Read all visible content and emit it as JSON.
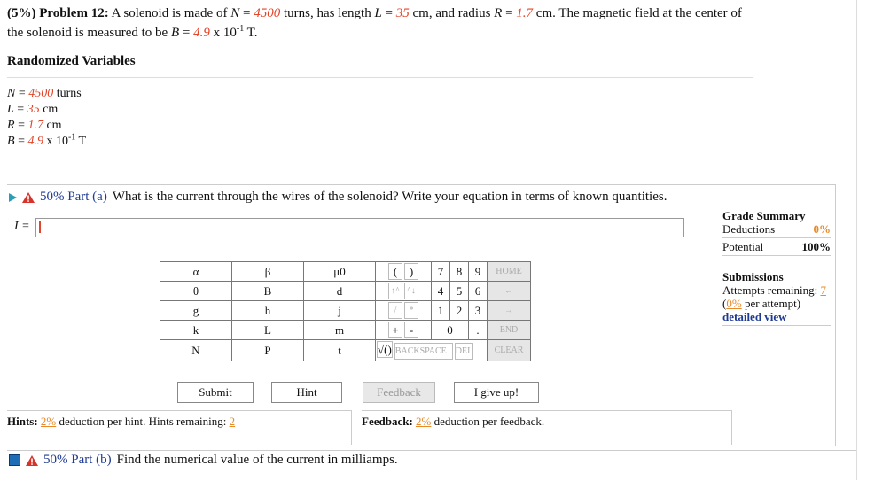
{
  "problem": {
    "pct": "(5%)",
    "label": "Problem 12:",
    "text1": " A solenoid is made of ",
    "N_sym": "N",
    "N_val": "4500",
    "text2": " turns, has length ",
    "L_sym": "L",
    "L_val": "35",
    "text3": " cm, and radius ",
    "R_sym": "R",
    "R_val": "1.7",
    "text4": " cm. The magnetic field at the center of the solenoid is measured to be ",
    "B_sym": "B",
    "B_val": "4.9",
    "B_mult": " x 10",
    "B_exp": "-1",
    "B_unit": " T."
  },
  "random_vars": {
    "title": "Randomized Variables",
    "items": [
      {
        "sym": "N",
        "val": "4500",
        "unit": " turns",
        "exp": ""
      },
      {
        "sym": "L",
        "val": "35",
        "unit": " cm",
        "exp": ""
      },
      {
        "sym": "R",
        "val": "1.7",
        "unit": " cm",
        "exp": ""
      },
      {
        "sym": "B",
        "val": "4.9",
        "unit": " T",
        "exp": "-1"
      }
    ]
  },
  "part_a": {
    "pct": "50%",
    "label": "Part (a)",
    "question": "What is the current through the wires of the solenoid? Write your equation in terms of known quantities.",
    "answer_label": "I =",
    "answer_value": ""
  },
  "keypad": {
    "greek": [
      [
        "α",
        "β",
        "μ0"
      ],
      [
        "θ",
        "B",
        "d"
      ],
      [
        "g",
        "h",
        "j"
      ],
      [
        "k",
        "L",
        "m"
      ],
      [
        "N",
        "P",
        "t"
      ]
    ],
    "numbers": [
      [
        "7",
        "8",
        "9"
      ],
      [
        "4",
        "5",
        "6"
      ],
      [
        "1",
        "2",
        "3"
      ]
    ],
    "home": "HOME",
    "end": "END",
    "backspace": "BACKSPACE",
    "del": "DEL",
    "clear": "CLEAR",
    "open_paren": "(",
    "close_paren": ")",
    "plus": "+",
    "minus": "-",
    "zero": "0",
    "dot": ".",
    "sqrt": "√()",
    "up_arrow": "↑^",
    "down_arrow": "^↓",
    "slash": "/",
    "star": "*",
    "left_arrow": "←",
    "right_arrow": "→"
  },
  "buttons": {
    "submit": "Submit",
    "hint": "Hint",
    "feedback": "Feedback",
    "give_up": "I give up!"
  },
  "hints": {
    "label": "Hints:",
    "pct": "2%",
    "text": " deduction per hint. Hints remaining:",
    "remaining": "2"
  },
  "feedback": {
    "label": "Feedback:",
    "pct": "2%",
    "text": " deduction per feedback."
  },
  "grade": {
    "title": "Grade Summary",
    "deductions_label": "Deductions",
    "deductions_val": "0%",
    "potential_label": "Potential",
    "potential_val": "100%",
    "submissions_title": "Submissions",
    "attempts_label": "Attempts remaining:",
    "attempts_val": "7",
    "per_attempt_pct": "0%",
    "per_attempt_text": " per attempt)",
    "detailed_view": "detailed view"
  },
  "part_b": {
    "pct": "50%",
    "label": "Part (b)",
    "question": "Find the numerical value of the current in milliamps."
  },
  "colors": {
    "accent_red": "#e2462a",
    "link_blue": "#1f3a93",
    "orange": "#e88a2a"
  }
}
